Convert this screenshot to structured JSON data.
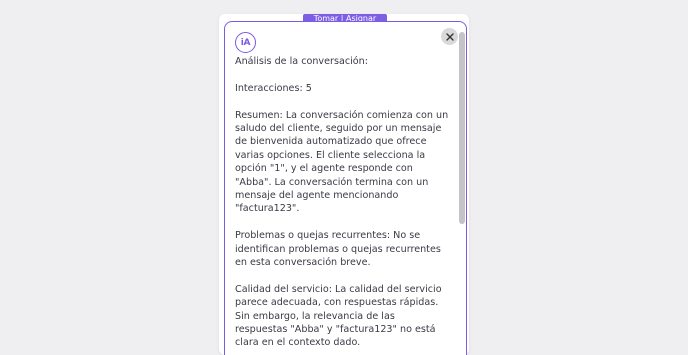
{
  "background_tab": {
    "label": "Tomar | Asignar"
  },
  "modal": {
    "logo_text": "iA",
    "close_icon": "close-icon",
    "accent_color": "#7b5be0",
    "title": "Análisis de la conversación:",
    "interactions": "Interacciones: 5",
    "summary": "Resumen: La conversación comienza con un saludo del cliente, seguido por un mensaje de bienvenida automatizado que ofrece varias opciones. El cliente selecciona la opción \"1\", y el agente responde con \"Abba\". La conversación termina con un mensaje del agente mencionando \"factura123\".",
    "problems": "Problemas o quejas recurrentes: No se identifican problemas o quejas recurrentes en esta conversación breve.",
    "quality": "Calidad del servicio: La calidad del servicio parece adecuada, con respuestas rápidas. Sin embargo, la relevancia de las respuestas \"Abba\" y \"factura123\" no está clara en el contexto dado."
  }
}
